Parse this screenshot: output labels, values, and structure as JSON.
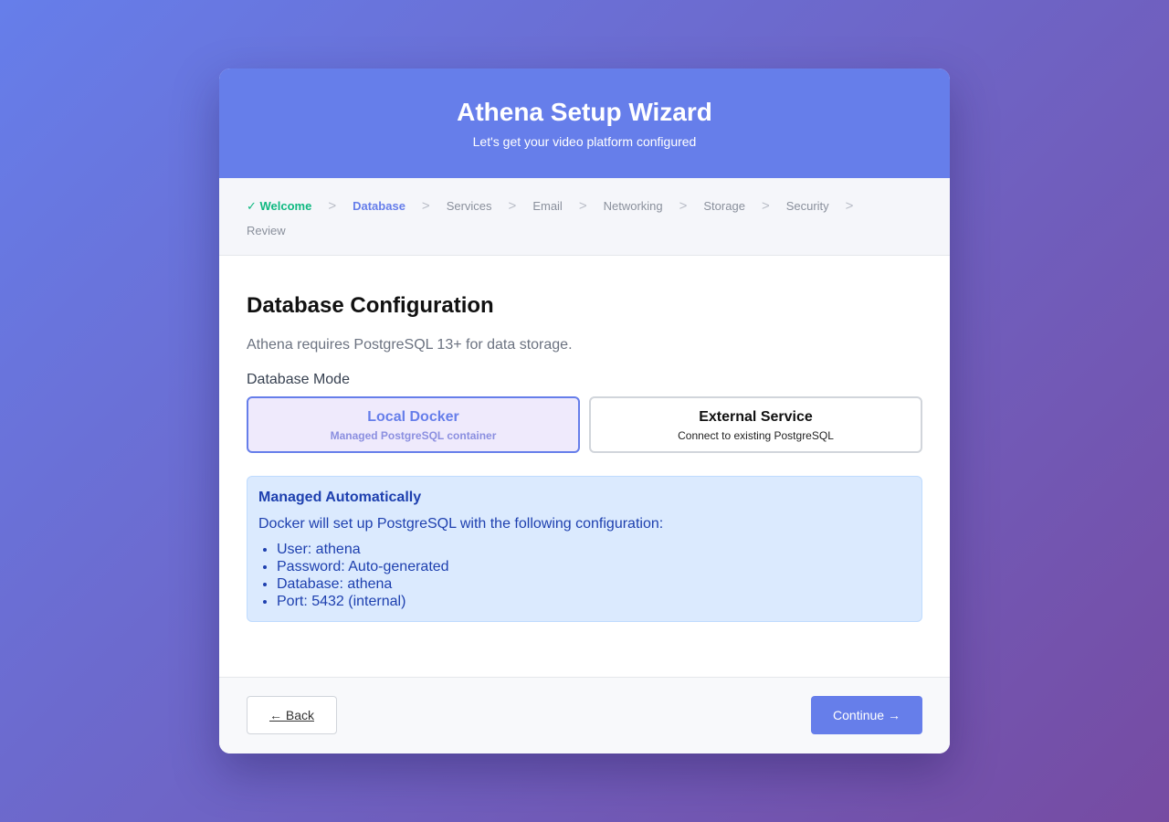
{
  "header": {
    "title": "Athena Setup Wizard",
    "subtitle": "Let's get your video platform configured"
  },
  "steps": [
    {
      "label": "✓ Welcome",
      "state": "done"
    },
    {
      "label": "Database",
      "state": "active"
    },
    {
      "label": "Services",
      "state": "pending"
    },
    {
      "label": "Email",
      "state": "pending"
    },
    {
      "label": "Networking",
      "state": "pending"
    },
    {
      "label": "Storage",
      "state": "pending"
    },
    {
      "label": "Security",
      "state": "pending"
    },
    {
      "label": "Review",
      "state": "pending"
    }
  ],
  "step_separator": ">",
  "content": {
    "title": "Database Configuration",
    "description": "Athena requires PostgreSQL 13+ for data storage.",
    "mode_label": "Database Mode",
    "modes": [
      {
        "title": "Local Docker",
        "subtitle": "Managed PostgreSQL container",
        "selected": true
      },
      {
        "title": "External Service",
        "subtitle": "Connect to existing PostgreSQL",
        "selected": false
      }
    ],
    "info": {
      "title": "Managed Automatically",
      "text": "Docker will set up PostgreSQL with the following configuration:",
      "items": [
        "User: athena",
        "Password: Auto-generated",
        "Database: athena",
        "Port: 5432 (internal)"
      ]
    }
  },
  "footer": {
    "back_label": "← Back",
    "continue_label": "Continue →"
  },
  "colors": {
    "accent": "#667eea",
    "done": "#10b981",
    "info_bg": "#dbeafe",
    "info_text": "#1e40af"
  }
}
